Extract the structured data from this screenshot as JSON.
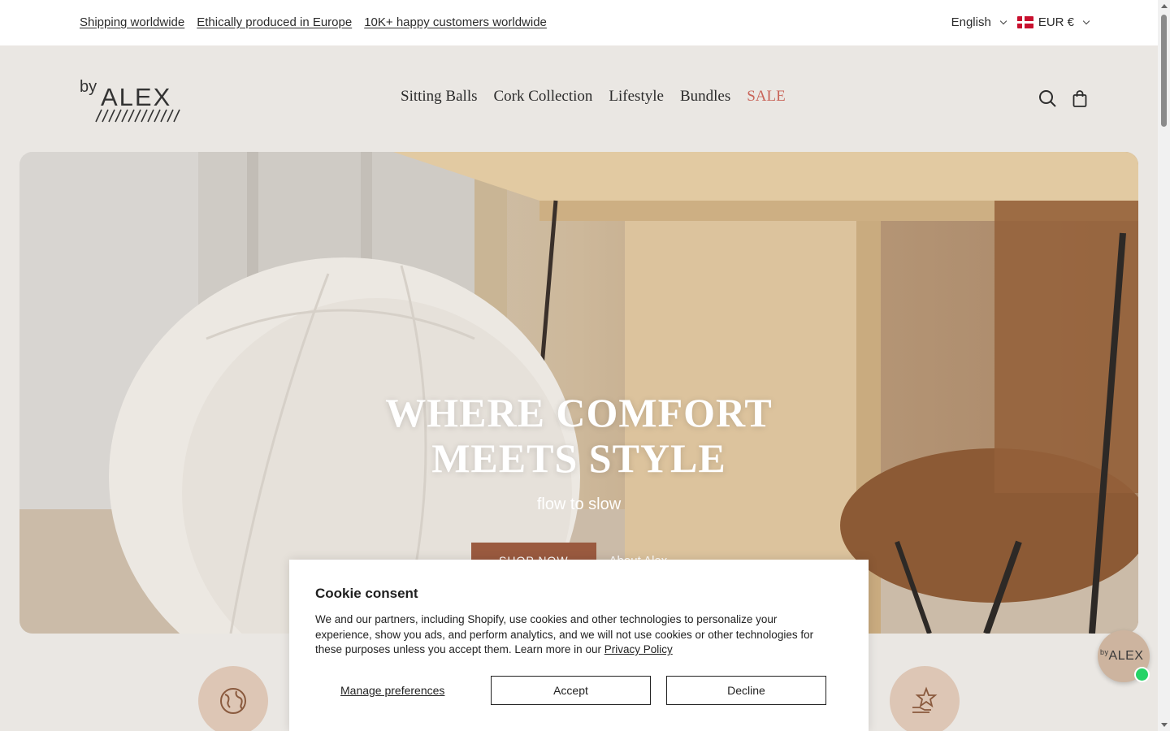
{
  "announcement": {
    "links": [
      "Shipping worldwide",
      "Ethically produced in Europe",
      "10K+ happy customers worldwide"
    ],
    "language": "English",
    "currency": "EUR €"
  },
  "header": {
    "logo_text": "byALEX",
    "nav": [
      "Sitting Balls",
      "Cork Collection",
      "Lifestyle",
      "Bundles",
      "SALE"
    ]
  },
  "hero": {
    "title": "WHERE COMFORT MEETS STYLE",
    "subtitle": "flow to slow",
    "primary_button": "SHOP NOW",
    "secondary_button": "About Alex"
  },
  "features": {
    "icons": [
      "globe-icon",
      "star-hand-icon"
    ]
  },
  "cookie": {
    "title": "Cookie consent",
    "body": "We and our partners, including Shopify, use cookies and other technologies to personalize your experience, show you ads, and perform analytics, and we will not use cookies or other technologies for these purposes unless you accept them. Learn more in our",
    "policy_link": "Privacy Policy",
    "manage": "Manage preferences",
    "accept": "Accept",
    "decline": "Decline"
  },
  "chat": {
    "label": "ALEX",
    "prefix": "by"
  },
  "colors": {
    "accent": "#9a5a3f",
    "sale": "#c9655a",
    "background": "#eae7e3"
  }
}
